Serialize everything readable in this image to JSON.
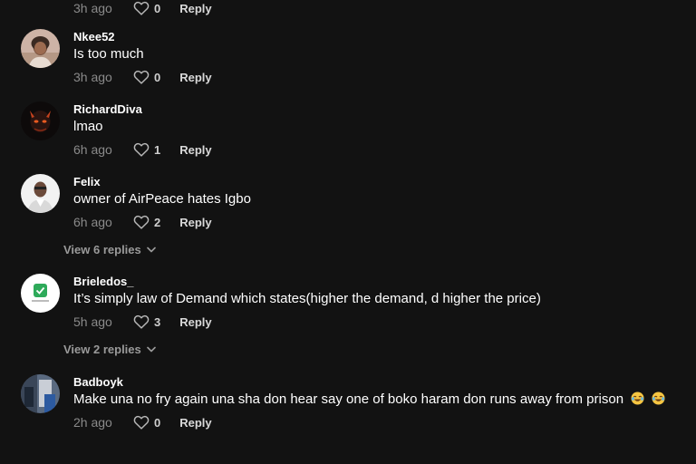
{
  "comments": [
    {
      "username": "",
      "text": "",
      "time": "3h ago",
      "likes": "0",
      "reply_label": "Reply"
    },
    {
      "username": "Nkee52",
      "text": "Is too much",
      "time": "3h ago",
      "likes": "0",
      "reply_label": "Reply"
    },
    {
      "username": "RichardDiva",
      "text": "lmao",
      "time": "6h ago",
      "likes": "1",
      "reply_label": "Reply"
    },
    {
      "username": "Felix",
      "text": "owner of AirPeace hates Igbo",
      "time": "6h ago",
      "likes": "2",
      "reply_label": "Reply",
      "view_replies": "View 6 replies"
    },
    {
      "username": "Brieledos_",
      "text": "It’s simply law of Demand which states(higher the demand, d higher the price)",
      "time": "5h ago",
      "likes": "3",
      "reply_label": "Reply",
      "view_replies": "View 2 replies"
    },
    {
      "username": "Badboyk",
      "text": "Make una no fry again una sha don hear say one of boko haram don runs away from prison",
      "emojis": "😂😂",
      "time": "2h ago",
      "likes": "0",
      "reply_label": "Reply"
    }
  ],
  "icons": {
    "like": "heart-outline-icon",
    "expand": "chevron-down-icon",
    "emoji": "face-with-tears-of-joy-icon"
  },
  "colors": {
    "background": "#121212",
    "text": "#ffffff",
    "muted": "#8a8a8a",
    "emoji": "#f5c542"
  }
}
